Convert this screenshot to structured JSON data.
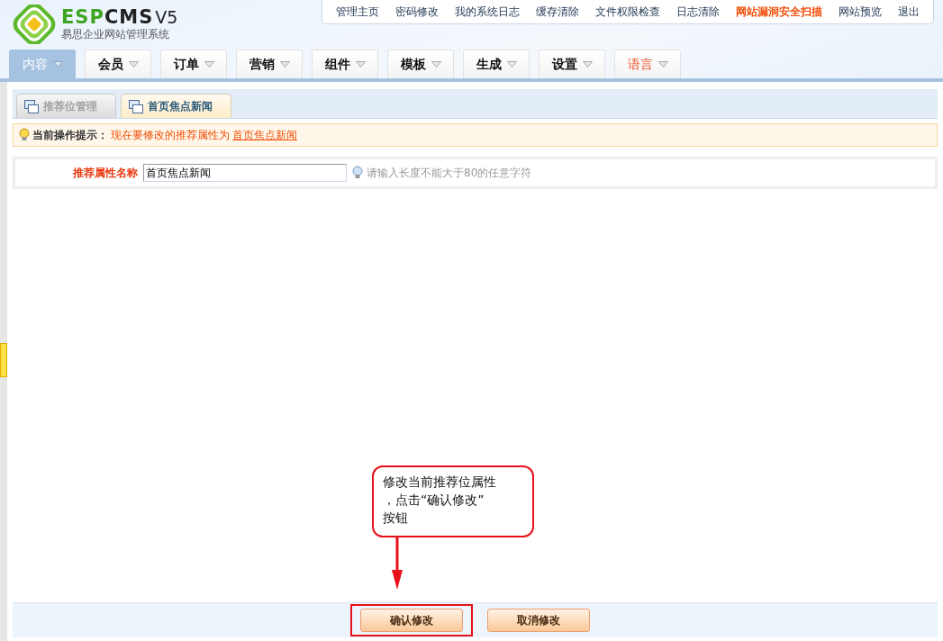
{
  "logo": {
    "brand_green": "ESP",
    "brand_dark": "CMS",
    "version": "V5",
    "subtitle": "易思企业网站管理系统"
  },
  "top_links": [
    {
      "label": "管理主页",
      "highlighted": false
    },
    {
      "label": "密码修改",
      "highlighted": false
    },
    {
      "label": "我的系统日志",
      "highlighted": false
    },
    {
      "label": "缓存清除",
      "highlighted": false
    },
    {
      "label": "文件权限检查",
      "highlighted": false
    },
    {
      "label": "日志清除",
      "highlighted": false
    },
    {
      "label": "网站漏洞安全扫描",
      "highlighted": true
    },
    {
      "label": "网站预览",
      "highlighted": false
    },
    {
      "label": "退出",
      "highlighted": false
    }
  ],
  "nav": [
    {
      "label": "内容",
      "selected": true,
      "highlighted": false
    },
    {
      "label": "会员",
      "selected": false,
      "highlighted": false
    },
    {
      "label": "订单",
      "selected": false,
      "highlighted": false
    },
    {
      "label": "营销",
      "selected": false,
      "highlighted": false
    },
    {
      "label": "组件",
      "selected": false,
      "highlighted": false
    },
    {
      "label": "模板",
      "selected": false,
      "highlighted": false
    },
    {
      "label": "生成",
      "selected": false,
      "highlighted": false
    },
    {
      "label": "设置",
      "selected": false,
      "highlighted": false
    },
    {
      "label": "语言",
      "selected": false,
      "highlighted": true
    }
  ],
  "tabs": [
    {
      "label": "推荐位管理",
      "selected": false
    },
    {
      "label": "首页焦点新闻",
      "selected": true
    }
  ],
  "hint": {
    "label": "当前操作提示：",
    "text": "现在要修改的推荐属性为",
    "link": "首页焦点新闻"
  },
  "form": {
    "label": "推荐属性名称",
    "value": "首页焦点新闻",
    "help": "请输入长度不能大于80的任意字符"
  },
  "buttons": [
    {
      "label": "确认修改",
      "highlighted": true
    },
    {
      "label": "取消修改",
      "highlighted": false
    }
  ],
  "annotation": {
    "lines": [
      "修改当前推荐位属性",
      "，点击“确认修改”",
      "按钮"
    ]
  }
}
